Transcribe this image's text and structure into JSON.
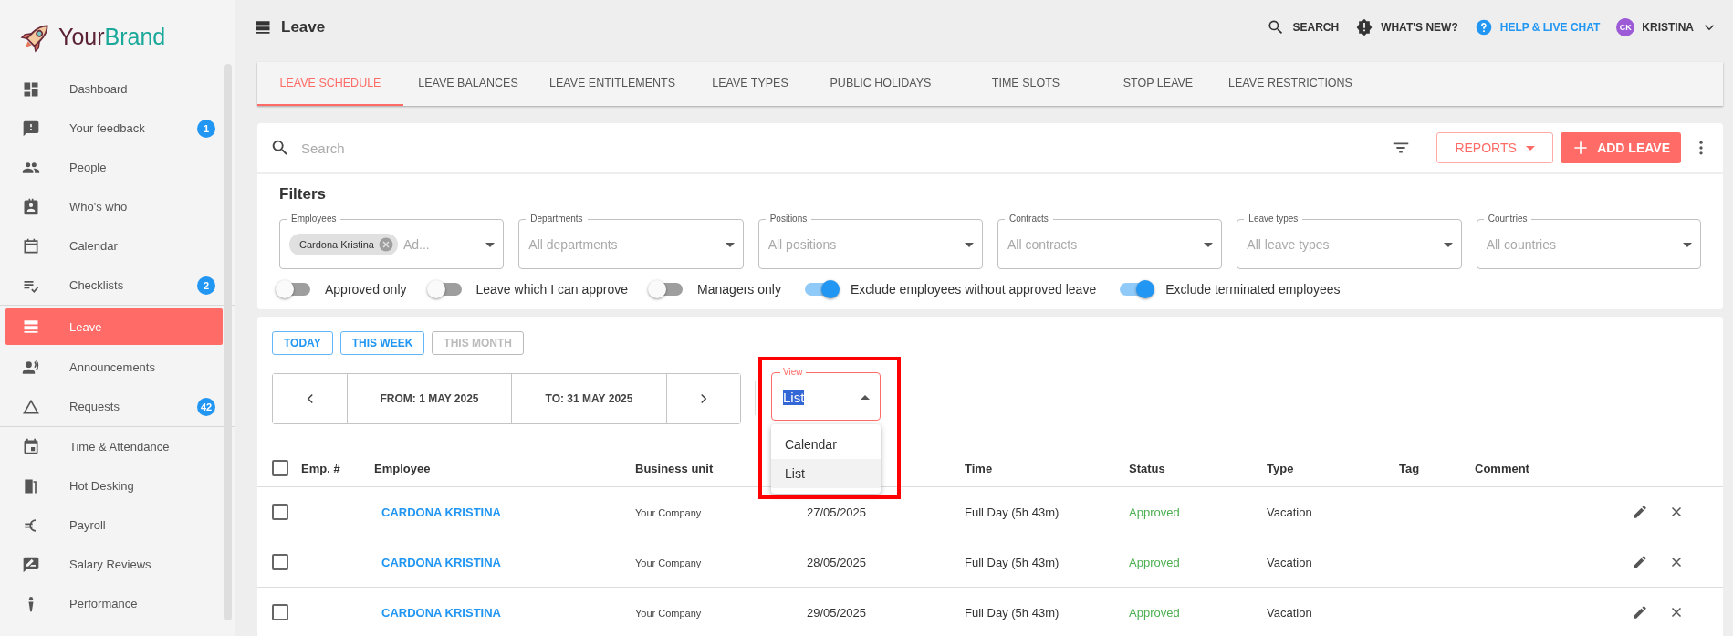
{
  "brand": {
    "part_1": "Your",
    "part_2": "Brand"
  },
  "sidebar": {
    "sections": [
      {
        "items": [
          {
            "label": "Dashboard",
            "selected": false
          },
          {
            "label": "Your feedback",
            "selected": false,
            "badge": "1"
          },
          {
            "label": "People",
            "selected": false
          },
          {
            "label": "Who's who",
            "selected": false
          },
          {
            "label": "Calendar",
            "selected": false
          },
          {
            "label": "Checklists",
            "selected": false,
            "badge": "2"
          }
        ]
      },
      {
        "items": [
          {
            "label": "Leave",
            "selected": true
          },
          {
            "label": "Announcements",
            "selected": false
          },
          {
            "label": "Requests",
            "selected": false,
            "badge": "42"
          }
        ]
      },
      {
        "items": [
          {
            "label": "Time & Attendance",
            "selected": false
          },
          {
            "label": "Hot Desking",
            "selected": false
          },
          {
            "label": "Payroll",
            "selected": false
          },
          {
            "label": "Salary Reviews",
            "selected": false
          },
          {
            "label": "Performance",
            "selected": false
          }
        ]
      }
    ]
  },
  "header": {
    "title": "Leave",
    "search": "SEARCH",
    "whats_new": "WHAT'S NEW?",
    "help": "HELP & LIVE CHAT",
    "user": {
      "initials": "CK",
      "name": "KRISTINA"
    }
  },
  "tabs": [
    {
      "label": "LEAVE SCHEDULE",
      "selected": true
    },
    {
      "label": "LEAVE BALANCES",
      "selected": false
    },
    {
      "label": "LEAVE ENTITLEMENTS",
      "selected": false
    },
    {
      "label": "LEAVE TYPES",
      "selected": false
    },
    {
      "label": "PUBLIC HOLIDAYS",
      "selected": false
    },
    {
      "label": "TIME SLOTS",
      "selected": false
    },
    {
      "label": "STOP LEAVE",
      "selected": false
    },
    {
      "label": "LEAVE RESTRICTIONS",
      "selected": false
    }
  ],
  "toolbar": {
    "search": {
      "placeholder": "Search"
    },
    "reports": "REPORTS",
    "add_leave": "ADD LEAVE"
  },
  "filters": {
    "title": "Filters",
    "fields": [
      {
        "label": "Employees",
        "chip": "Cardona Kristina",
        "placeholder": "Ad..."
      },
      {
        "label": "Departments",
        "placeholder": "All departments"
      },
      {
        "label": "Positions",
        "placeholder": "All positions"
      },
      {
        "label": "Contracts",
        "placeholder": "All contracts"
      },
      {
        "label": "Leave types",
        "placeholder": "All leave types"
      },
      {
        "label": "Countries",
        "placeholder": "All countries"
      }
    ],
    "toggles": [
      {
        "label": "Approved only",
        "on": false
      },
      {
        "label": "Leave which I can approve",
        "on": false
      },
      {
        "label": "Managers only",
        "on": false
      },
      {
        "label": "Exclude employees without approved leave",
        "on": true
      },
      {
        "label": "Exclude terminated employees",
        "on": true
      }
    ]
  },
  "quick_ranges": [
    {
      "label": "TODAY",
      "disabled": false
    },
    {
      "label": "THIS WEEK",
      "disabled": false
    },
    {
      "label": "THIS MONTH",
      "disabled": true
    }
  ],
  "date_range": {
    "from": "FROM: 1 MAY 2025",
    "to": "TO: 31 MAY 2025"
  },
  "view": {
    "label": "View",
    "value": "List",
    "options": [
      {
        "label": "Calendar",
        "selected": false
      },
      {
        "label": "List",
        "selected": true
      }
    ]
  },
  "table": {
    "select_all_checked": false,
    "columns": [
      "Emp. #",
      "Employee",
      "Business unit",
      "Time",
      "Status",
      "Type",
      "Tag",
      "Comment"
    ],
    "rows": [
      {
        "checked": false,
        "employee": "CARDONA KRISTINA",
        "business_unit": "Your Company",
        "date": "27/05/2025",
        "time": "Full Day (5h 43m)",
        "status": "Approved",
        "type": "Vacation"
      },
      {
        "checked": false,
        "employee": "CARDONA KRISTINA",
        "business_unit": "Your Company",
        "date": "28/05/2025",
        "time": "Full Day (5h 43m)",
        "status": "Approved",
        "type": "Vacation"
      },
      {
        "checked": false,
        "employee": "CARDONA KRISTINA",
        "business_unit": "Your Company",
        "date": "29/05/2025",
        "time": "Full Day (5h 43m)",
        "status": "Approved",
        "type": "Vacation"
      }
    ]
  }
}
